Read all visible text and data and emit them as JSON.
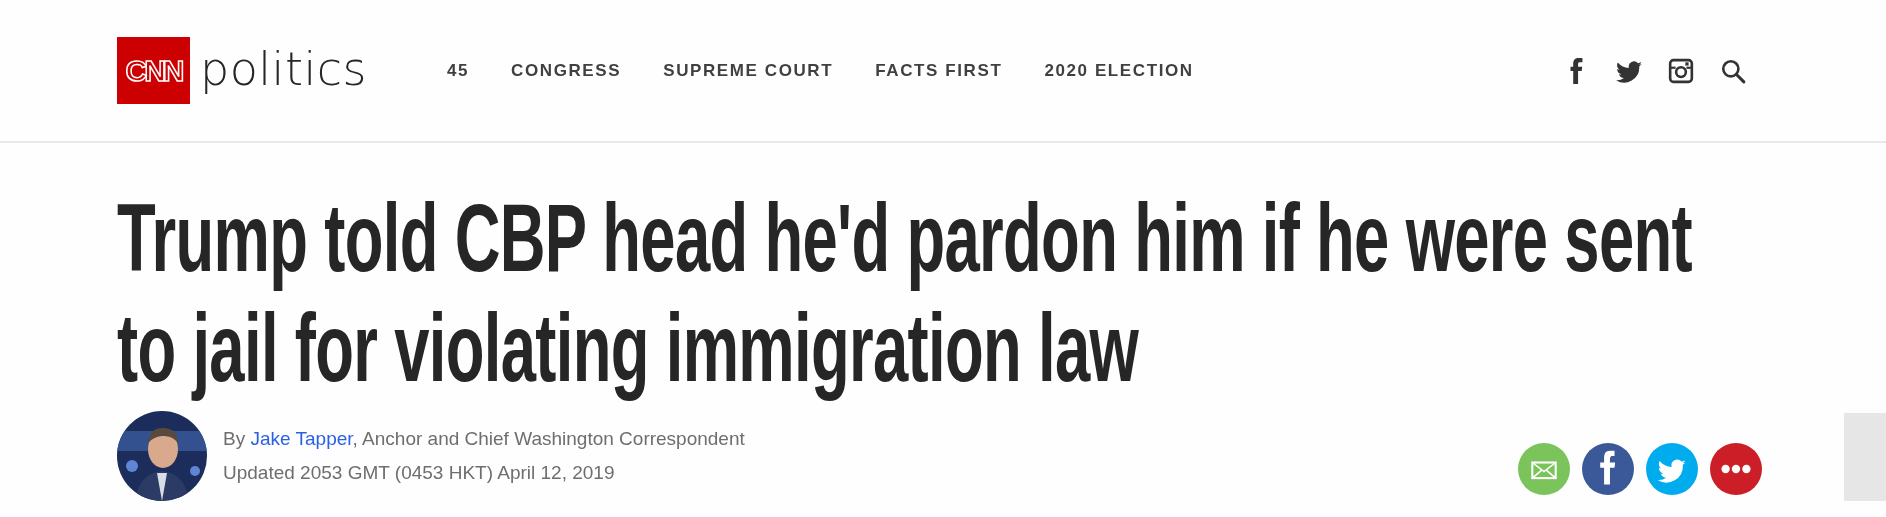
{
  "header": {
    "logo": {
      "brand": "CNN",
      "section": "politics"
    },
    "nav": [
      {
        "label": "45"
      },
      {
        "label": "CONGRESS"
      },
      {
        "label": "SUPREME COURT"
      },
      {
        "label": "FACTS FIRST"
      },
      {
        "label": "2020 ELECTION"
      }
    ],
    "social": [
      {
        "kind": "facebook"
      },
      {
        "kind": "twitter"
      },
      {
        "kind": "instagram"
      },
      {
        "kind": "search"
      }
    ]
  },
  "article": {
    "headline": "Trump told CBP head he'd pardon him if he were sent to jail for violating immigration law",
    "byline": {
      "prefix": "By",
      "author": "Jake Tapper",
      "role": ", Anchor and Chief Washington Correspondent"
    },
    "updated": "Updated 2053 GMT (0453 HKT) April 12, 2019",
    "share": [
      {
        "kind": "email",
        "color": "#7bc45b"
      },
      {
        "kind": "facebook",
        "color": "#3b5998"
      },
      {
        "kind": "twitter",
        "color": "#00acee"
      },
      {
        "kind": "more",
        "color": "#cc1e27"
      }
    ]
  }
}
